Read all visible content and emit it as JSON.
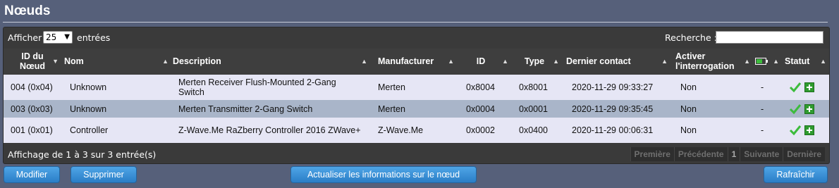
{
  "page": {
    "title": "Nœuds"
  },
  "toolbar": {
    "show_label": "Afficher",
    "page_size": "25",
    "show_after": "entrées",
    "search_label": "Recherche :",
    "search_value": ""
  },
  "table": {
    "columns": [
      "ID du Nœud",
      "Nom",
      "Description",
      "Manufacturer",
      "ID",
      "Type",
      "Dernier contact",
      "Activer l'interrogation",
      "battery-icon",
      "Statut"
    ],
    "rows": [
      {
        "node_id": "004 (0x04)",
        "name": "Unknown",
        "description": "Merten Receiver Flush-Mounted 2-Gang Switch",
        "manufacturer": "Merten",
        "id": "0x8004",
        "type": "0x8001",
        "last_contact": "2020-11-29 09:33:27",
        "polling": "Non",
        "battery": "-"
      },
      {
        "node_id": "003 (0x03)",
        "name": "Unknown",
        "description": "Merten Transmitter 2-Gang Switch",
        "manufacturer": "Merten",
        "id": "0x0004",
        "type": "0x0001",
        "last_contact": "2020-11-29 09:35:45",
        "polling": "Non",
        "battery": "-"
      },
      {
        "node_id": "001 (0x01)",
        "name": "Controller",
        "description": "Z-Wave.Me RaZberry Controller 2016 ZWave+",
        "manufacturer": "Z-Wave.Me",
        "id": "0x0002",
        "type": "0x0400",
        "last_contact": "2020-11-29 00:06:31",
        "polling": "Non",
        "battery": "-"
      }
    ]
  },
  "footer": {
    "info": "Affichage de 1 à 3 sur 3 entrée(s)",
    "pager": [
      "Première",
      "Précédente",
      "1",
      "Suivante",
      "Dernière"
    ]
  },
  "buttons": {
    "modify": "Modifier",
    "delete": "Supprimer",
    "refresh_info": "Actualiser les informations sur le nœud",
    "reload": "Rafraîchir"
  },
  "colors": {
    "background": "#56607a",
    "accent": "#2a7ec7",
    "row_odd": "#e6e6f5",
    "row_even": "#a9b5c9",
    "status_ok": "#3cbc3c"
  }
}
